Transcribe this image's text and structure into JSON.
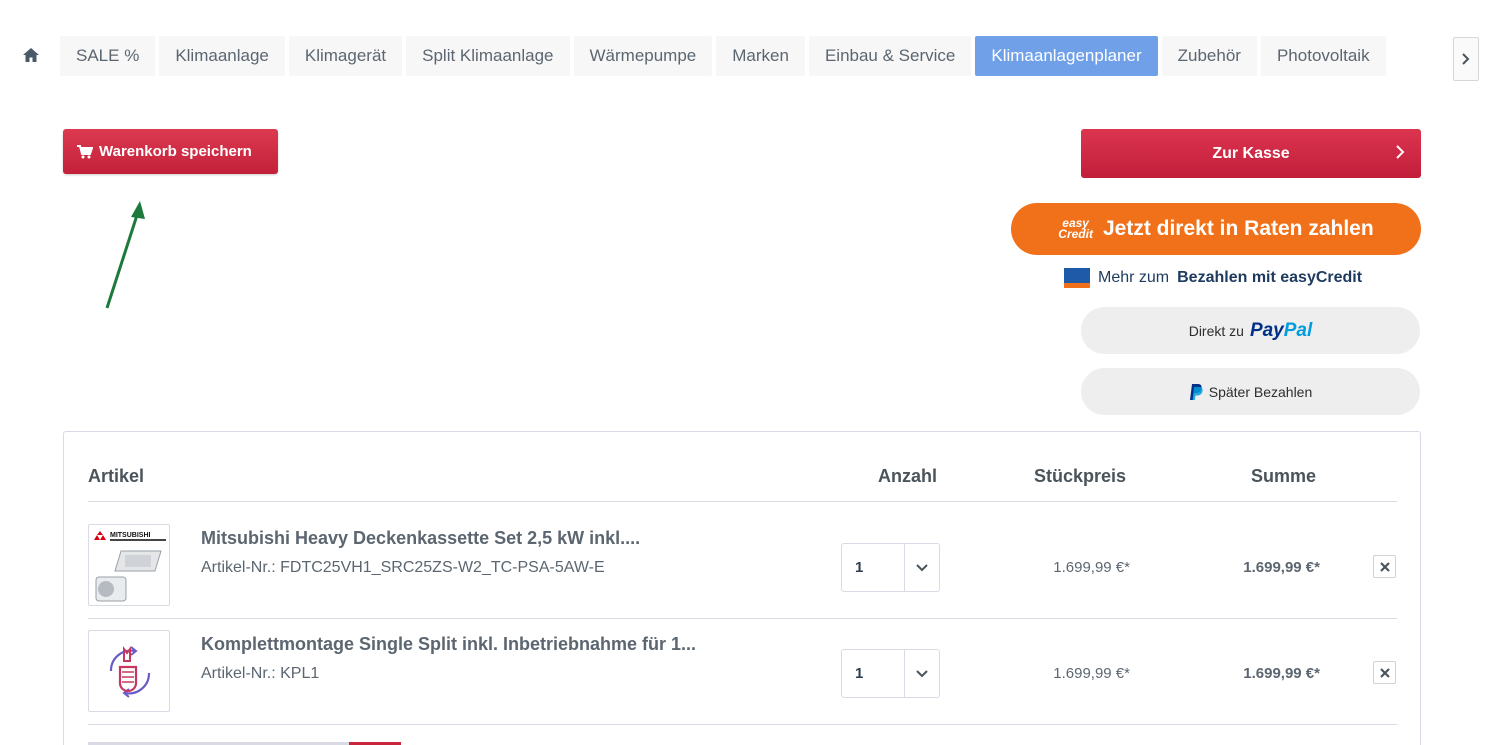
{
  "nav": {
    "items": [
      {
        "label": "SALE %"
      },
      {
        "label": "Klimaanlage"
      },
      {
        "label": "Klimagerät"
      },
      {
        "label": "Split Klimaanlage"
      },
      {
        "label": "Wärmepumpe"
      },
      {
        "label": "Marken"
      },
      {
        "label": "Einbau & Service"
      },
      {
        "label": "Klimaanlagenplaner",
        "active": true
      },
      {
        "label": "Zubehör"
      },
      {
        "label": "Photovoltaik"
      }
    ]
  },
  "actions": {
    "save_cart_label": "Warenkorb speichern",
    "checkout_label": "Zur Kasse",
    "easycredit_logo_top": "easy",
    "easycredit_logo_bottom": "Credit",
    "easycredit_label": "Jetzt direkt in Raten zahlen",
    "easycredit_info_prefix": "Mehr zum",
    "easycredit_info_bold": "Bezahlen mit easyCredit",
    "paypal_prefix": "Direkt zu",
    "paypal_word_a": "Pay",
    "paypal_word_b": "Pal",
    "paypal_later_label": "Später Bezahlen"
  },
  "cart": {
    "headers": {
      "article": "Artikel",
      "quantity": "Anzahl",
      "unit_price": "Stückpreis",
      "total": "Summe"
    },
    "items": [
      {
        "title": "Mitsubishi Heavy Deckenkassette Set 2,5 kW inkl....",
        "sku": "Artikel-Nr.: FDTC25VH1_SRC25ZS-W2_TC-PSA-5AW-E",
        "quantity": "1",
        "unit_price": "1.699,99 €*",
        "total": "1.699,99 €*",
        "brand_text": "MITSUBISHI"
      },
      {
        "title": "Komplettmontage Single Split inkl. Inbetriebnahme für 1...",
        "sku": "Artikel-Nr.: KPL1",
        "quantity": "1",
        "unit_price": "1.699,99 €*",
        "total": "1.699,99 €*"
      }
    ]
  },
  "colors": {
    "accent_red": "#c9263e",
    "nav_active": "#6fa0e8",
    "easycredit_orange": "#f07119",
    "annotation_arrow": "#1e7a3c"
  }
}
